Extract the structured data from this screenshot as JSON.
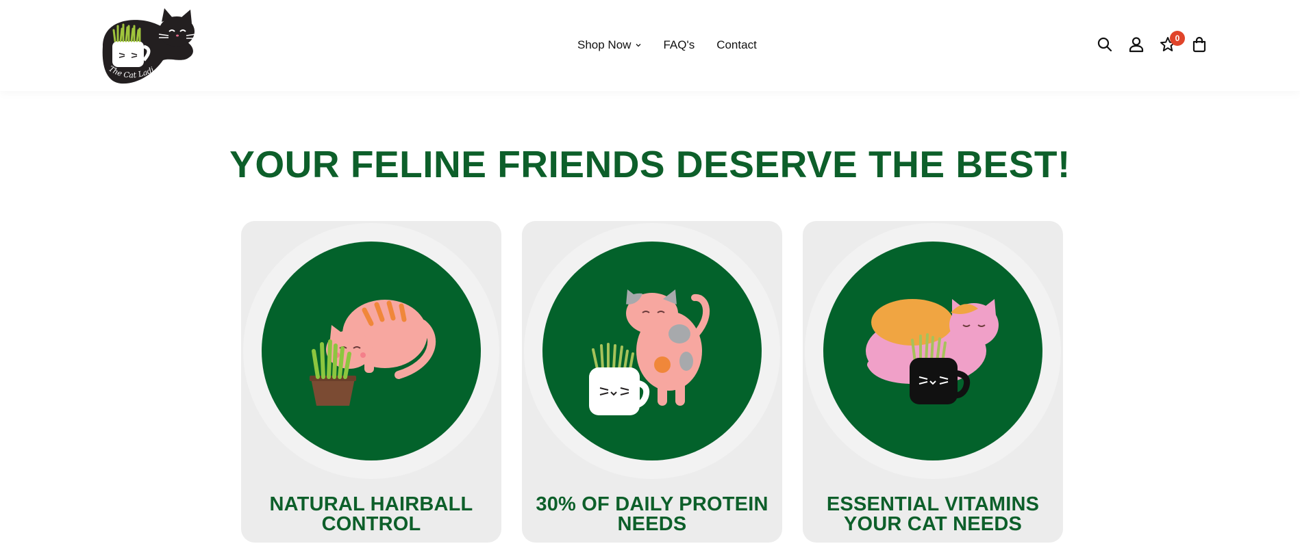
{
  "header": {
    "logo_text": "The Cat Ladies",
    "nav": [
      {
        "label": "Shop Now",
        "has_dropdown": true
      },
      {
        "label": "FAQ's"
      },
      {
        "label": "Contact"
      }
    ],
    "icons": [
      "search-icon",
      "account-icon",
      "wishlist-star-icon",
      "cart-bag-icon"
    ],
    "wishlist_count": "0"
  },
  "main": {
    "headline": "YOUR FELINE FRIENDS DESERVE THE BEST!",
    "cards": [
      {
        "title": "NATURAL HAIRBALL CONTROL",
        "image": "pink-cat-grass-pot"
      },
      {
        "title": "30% OF DAILY PROTEIN NEEDS",
        "image": "calico-cat-white-mug"
      },
      {
        "title": "ESSENTIAL VITAMINS YOUR CAT NEEDS",
        "image": "sleeping-cat-black-mug"
      }
    ]
  },
  "colors": {
    "brand_green": "#0d5f2a",
    "circle_green": "#03622b",
    "card_bg": "#ececec",
    "badge": "#e0442a"
  }
}
